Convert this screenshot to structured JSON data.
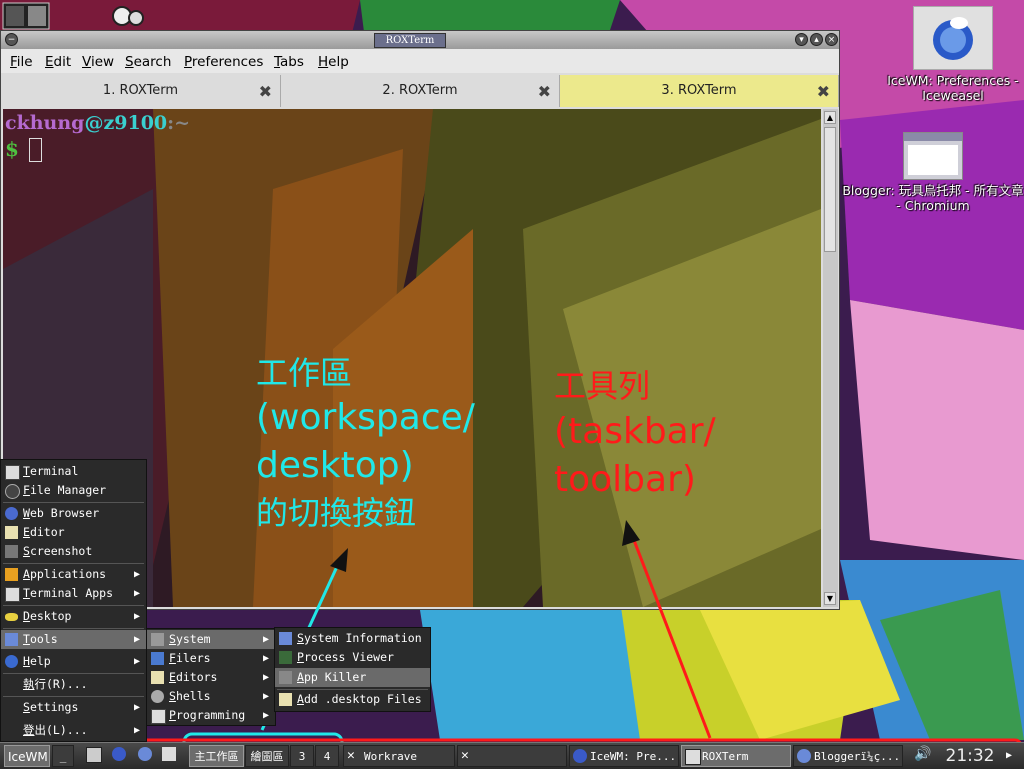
{
  "window": {
    "title": "ROXTerm",
    "menu": [
      "File",
      "Edit",
      "View",
      "Search",
      "Preferences",
      "Tabs",
      "Help"
    ],
    "tabs": [
      {
        "label": "1. ROXTerm",
        "active": false
      },
      {
        "label": "2. ROXTerm",
        "active": false
      },
      {
        "label": "3. ROXTerm",
        "active": true
      }
    ],
    "terminal": {
      "user": "ckhung",
      "at": "@",
      "host": "z9100",
      "sep": ":",
      "dir": "~",
      "dollar": "$"
    }
  },
  "desktop_icons": [
    {
      "label": "IceWM: Preferences - Iceweasel",
      "icon": "iceweasel-icon"
    },
    {
      "label": "Blogger: 玩具烏托邦 - 所有文章 - Chromium",
      "icon": "window-thumbnail-icon"
    }
  ],
  "annotations": {
    "workspace": {
      "line1": "工作區",
      "line2": "(workspace/",
      "line3": "desktop)",
      "line4": "的切換按鈕",
      "color": "#20e8e8"
    },
    "taskbar": {
      "line1": "工具列",
      "line2": "(taskbar/",
      "line3": "toolbar)",
      "color": "#ff1a1a"
    }
  },
  "start_menu": {
    "items": [
      {
        "label": "Terminal",
        "icon": "terminal-icon"
      },
      {
        "label": "File Manager",
        "icon": "folder-icon"
      },
      {
        "label": "Web Browser",
        "icon": "globe-icon"
      },
      {
        "label": "Editor",
        "icon": "edit-icon"
      },
      {
        "label": "Screenshot",
        "icon": "camera-icon"
      },
      {
        "label": "Applications",
        "icon": "apps-icon",
        "submenu": true
      },
      {
        "label": "Terminal Apps",
        "icon": "terminal-icon",
        "submenu": true
      },
      {
        "label": "Desktop",
        "icon": "desktop-icon",
        "submenu": true
      },
      {
        "label": "Tools",
        "icon": "tools-icon",
        "submenu": true,
        "selected": true
      },
      {
        "label": "Help",
        "icon": "help-icon",
        "submenu": true
      },
      {
        "label": "執行(R)...",
        "icon": ""
      },
      {
        "label": "Settings",
        "icon": "",
        "submenu": true
      },
      {
        "label": "登出(L)...",
        "icon": "",
        "submenu": true
      }
    ]
  },
  "tools_menu": {
    "items": [
      {
        "label": "System",
        "icon": "wrench-icon",
        "submenu": true,
        "selected": true
      },
      {
        "label": "Filers",
        "icon": "folder-icon",
        "submenu": true
      },
      {
        "label": "Editors",
        "icon": "edit-icon",
        "submenu": true
      },
      {
        "label": "Shells",
        "icon": "gear-icon",
        "submenu": true
      },
      {
        "label": "Programming",
        "icon": "monitor-icon",
        "submenu": true
      }
    ]
  },
  "system_menu": {
    "items": [
      {
        "label": "System Information",
        "icon": "monitor-icon"
      },
      {
        "label": "Process Viewer",
        "icon": "process-icon"
      },
      {
        "label": "App Killer",
        "icon": "kill-icon",
        "selected": true
      },
      {
        "label": "Add .desktop Files",
        "icon": "edit-icon"
      }
    ]
  },
  "taskbar": {
    "start": "IceWM",
    "workspaces": [
      "主工作區",
      "繪圖區",
      "3",
      "4"
    ],
    "tasks": [
      {
        "label": "Workrave",
        "icon": "x-icon"
      },
      {
        "label": "",
        "icon": "x-icon"
      },
      {
        "label": "IceWM: Pre...",
        "icon": "iceweasel-icon"
      },
      {
        "label": "ROXTerm",
        "icon": "monitor-icon",
        "active": true
      },
      {
        "label": "Bloggerï¼ç...",
        "icon": "chromium-icon"
      }
    ],
    "clock": "21:32"
  }
}
